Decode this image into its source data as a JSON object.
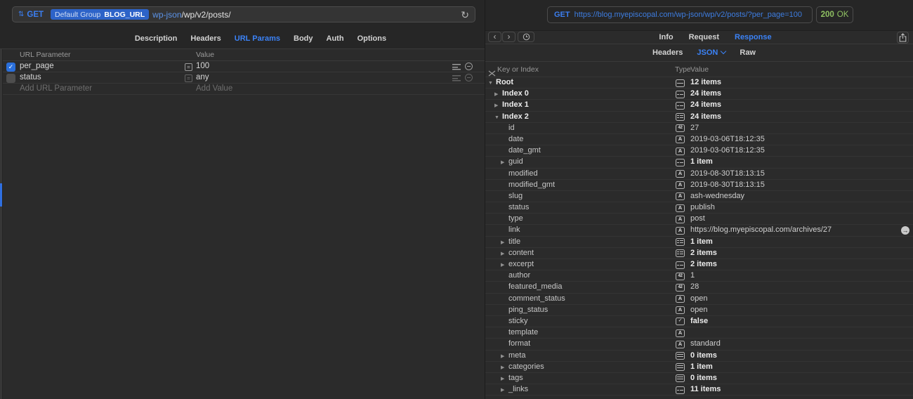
{
  "colors": {
    "accent_blue": "#3b7ef0",
    "pill_blue": "#2d63c8",
    "status_green": "#8fc162",
    "selection_blue": "#2f6fe0"
  },
  "icons": {
    "method-sort": "⇅",
    "refresh": "↻",
    "back": "‹",
    "forward": "›",
    "history": "clock",
    "share": "square-with-up-arrow",
    "collapse-all": "inward-x",
    "json-dropdown": "chevron-down",
    "param-reorder": "justify-lines",
    "param-remove": "minus-circle",
    "link-open": "→",
    "disclosure-open": "▼",
    "disclosure-closed": "▶",
    "type-string": "A",
    "type-number": "42",
    "type-bool": "✓",
    "type-list": "lines-box",
    "type-dict": "grid-box"
  },
  "request": {
    "method": "GET",
    "env_group": "Default Group",
    "env_var": "BLOG_URL",
    "url_var_part": "wp-json",
    "url_path": "/wp/v2/posts/",
    "tabs": [
      "Description",
      "Headers",
      "URL Params",
      "Body",
      "Auth",
      "Options"
    ],
    "active_tab": "URL Params",
    "params": {
      "header_name": "URL Parameter",
      "header_value": "Value",
      "rows": [
        {
          "name": "per_page",
          "value": "100",
          "enabled": true
        },
        {
          "name": "status",
          "value": "any",
          "enabled": false
        }
      ],
      "add_name_placeholder": "Add URL Parameter",
      "add_value_placeholder": "Add Value"
    }
  },
  "response": {
    "method": "GET",
    "url": "https://blog.myepiscopal.com/wp-json/wp/v2/posts/?per_page=100",
    "status_code": "200",
    "status_text": "OK",
    "tabs": [
      "Info",
      "Request",
      "Response"
    ],
    "active_tab": "Response",
    "subtabs": [
      "Headers",
      "JSON",
      "Raw"
    ],
    "active_subtab": "JSON",
    "tree": {
      "header_key": "Key or Index",
      "header_type": "Type",
      "header_value": "Value",
      "rows": [
        {
          "key": "Root",
          "level": 0,
          "disc": "open",
          "type": "list",
          "value": "12 items",
          "bk": true,
          "bv": true
        },
        {
          "key": "Index 0",
          "level": 1,
          "disc": "closed",
          "type": "dict",
          "value": "24 items",
          "bk": true,
          "bv": true
        },
        {
          "key": "Index 1",
          "level": 1,
          "disc": "closed",
          "type": "dict",
          "value": "24 items",
          "bk": true,
          "bv": true
        },
        {
          "key": "Index 2",
          "level": 1,
          "disc": "open",
          "type": "dict",
          "value": "24 items",
          "bk": true,
          "bv": true
        },
        {
          "key": "id",
          "level": 2,
          "type": "num",
          "value": "27"
        },
        {
          "key": "date",
          "level": 2,
          "type": "str",
          "value": "2019-03-06T18:12:35"
        },
        {
          "key": "date_gmt",
          "level": 2,
          "type": "str",
          "value": "2019-03-06T18:12:35"
        },
        {
          "key": "guid",
          "level": 2,
          "disc": "closed",
          "type": "dict",
          "value": "1 item",
          "bv": true
        },
        {
          "key": "modified",
          "level": 2,
          "type": "str",
          "value": "2019-08-30T18:13:15"
        },
        {
          "key": "modified_gmt",
          "level": 2,
          "type": "str",
          "value": "2019-08-30T18:13:15"
        },
        {
          "key": "slug",
          "level": 2,
          "type": "str",
          "value": "ash-wednesday"
        },
        {
          "key": "status",
          "level": 2,
          "type": "str",
          "value": "publish"
        },
        {
          "key": "type",
          "level": 2,
          "type": "str",
          "value": "post"
        },
        {
          "key": "link",
          "level": 2,
          "type": "str",
          "value": "https://blog.myepiscopal.com/archives/27",
          "la": true
        },
        {
          "key": "title",
          "level": 2,
          "disc": "closed",
          "type": "dict",
          "value": "1 item",
          "bv": true
        },
        {
          "key": "content",
          "level": 2,
          "disc": "closed",
          "type": "dict",
          "value": "2 items",
          "bv": true
        },
        {
          "key": "excerpt",
          "level": 2,
          "disc": "closed",
          "type": "dict",
          "value": "2 items",
          "bv": true
        },
        {
          "key": "author",
          "level": 2,
          "type": "num",
          "value": "1"
        },
        {
          "key": "featured_media",
          "level": 2,
          "type": "num",
          "value": "28"
        },
        {
          "key": "comment_status",
          "level": 2,
          "type": "str",
          "value": "open"
        },
        {
          "key": "ping_status",
          "level": 2,
          "type": "str",
          "value": "open"
        },
        {
          "key": "sticky",
          "level": 2,
          "type": "bool",
          "value": "false",
          "bv": true
        },
        {
          "key": "template",
          "level": 2,
          "type": "str",
          "value": ""
        },
        {
          "key": "format",
          "level": 2,
          "type": "str",
          "value": "standard"
        },
        {
          "key": "meta",
          "level": 2,
          "disc": "closed",
          "type": "list",
          "value": "0 items",
          "bv": true
        },
        {
          "key": "categories",
          "level": 2,
          "disc": "closed",
          "type": "list",
          "value": "1 item",
          "bv": true
        },
        {
          "key": "tags",
          "level": 2,
          "disc": "closed",
          "type": "list",
          "value": "0 items",
          "bv": true
        },
        {
          "key": "_links",
          "level": 2,
          "disc": "closed",
          "type": "dict",
          "value": "11 items",
          "bv": true
        }
      ]
    }
  }
}
